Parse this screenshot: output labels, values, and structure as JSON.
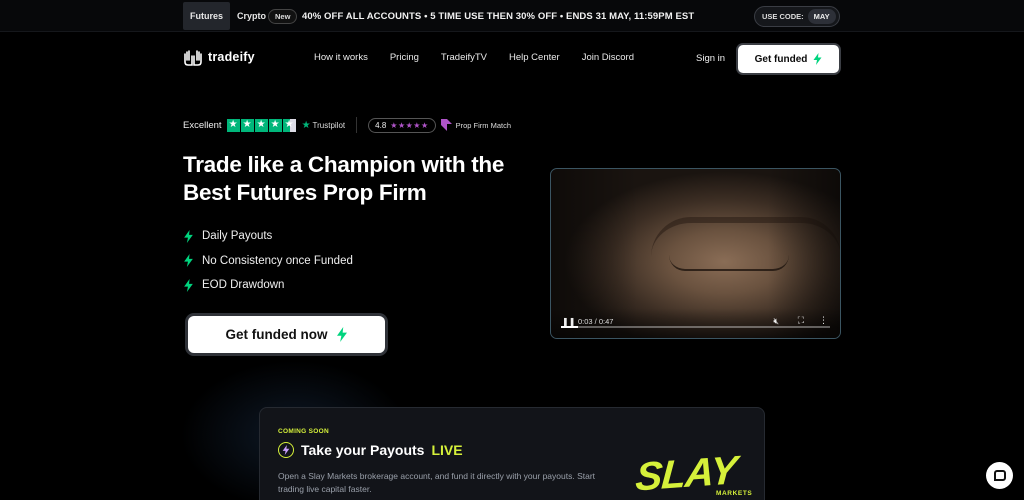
{
  "promo": {
    "tabs": [
      {
        "label": "Futures",
        "active": true
      },
      {
        "label": "Crypto",
        "active": false
      }
    ],
    "new_badge": "New",
    "message": "40% OFF ALL ACCOUNTS  •  5 TIME USE THEN 30% OFF  •  ENDS 31 MAY, 11:59PM EST",
    "code_label": "USE CODE:",
    "code_value": "MAY"
  },
  "nav": {
    "logo": "tradeify",
    "links": [
      "How it works",
      "Pricing",
      "TradeifyTV",
      "Help Center",
      "Join Discord"
    ],
    "sign_in": "Sign in",
    "cta": "Get funded"
  },
  "ratings": {
    "trustpilot_word": "Excellent",
    "trustpilot_brand": "Trustpilot",
    "trustpilot_stars": 4.5,
    "pfm_score": "4.8",
    "pfm_stars": "★★★★★",
    "pfm_name": "Prop Firm Match"
  },
  "hero": {
    "title": "Trade like a Champion with the Best Futures Prop Firm",
    "features": [
      "Daily Payouts",
      "No Consistency once Funded",
      "EOD Drawdown"
    ],
    "cta": "Get funded now"
  },
  "video": {
    "time": "0:03 / 0:47",
    "progress": 0.064
  },
  "card": {
    "coming_soon": "COMING SOON",
    "title_prefix": "Take your Payouts",
    "title_highlight": "LIVE",
    "description": "Open a Slay Markets brokerage account, and fund it directly with your payouts. Start trading live capital faster.",
    "brand_word": "SLAY",
    "brand_sub": "MARKETS"
  },
  "colors": {
    "accent_green": "#00d47e",
    "slay_yellow": "#d6f13a",
    "trustpilot_green": "#00b67a",
    "pfm_purple": "#b054c9"
  }
}
